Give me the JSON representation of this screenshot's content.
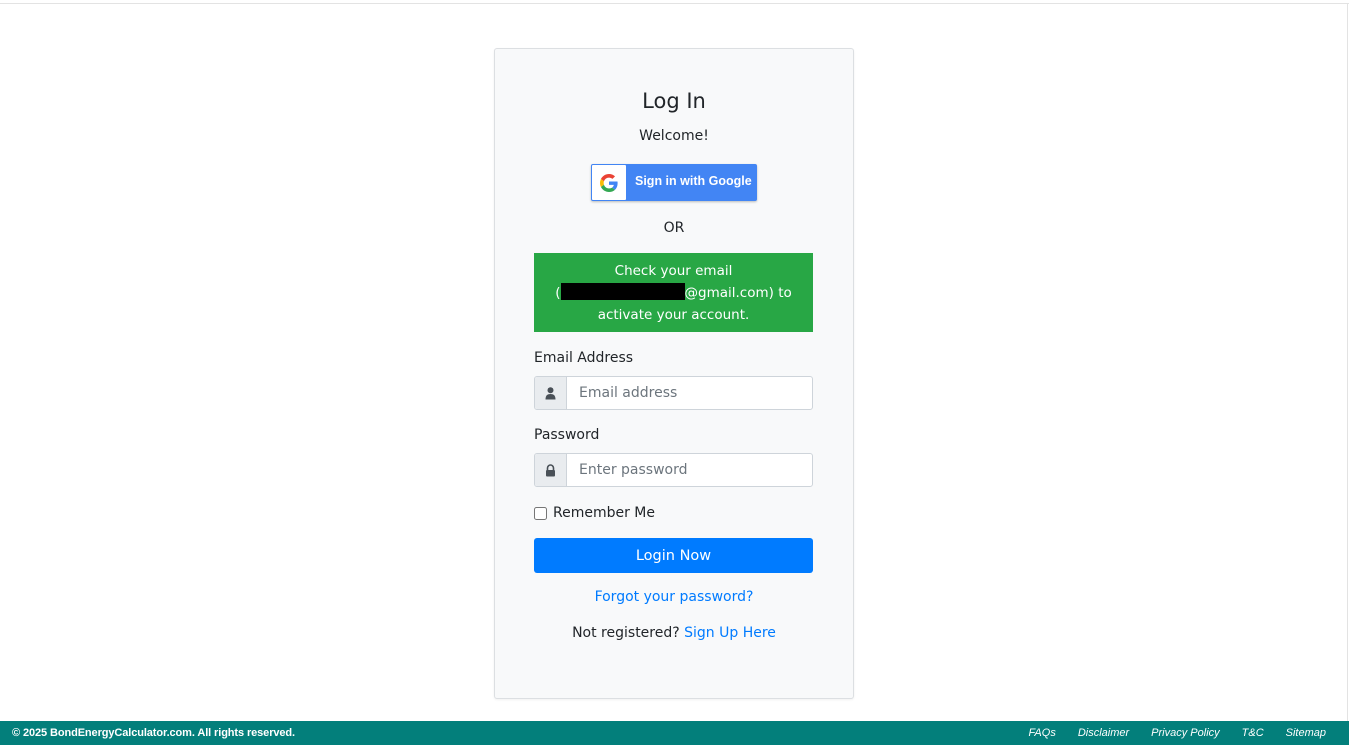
{
  "login": {
    "title": "Log In",
    "welcome": "Welcome!",
    "google_button_label": "Sign in with Google",
    "or_text": "OR",
    "alert": {
      "line1": "Check your email",
      "line2_prefix": "(",
      "line2_suffix": "@gmail.com) to",
      "line3": "activate your account."
    },
    "email": {
      "label": "Email Address",
      "placeholder": "Email address",
      "icon": "user-icon"
    },
    "password": {
      "label": "Password",
      "placeholder": "Enter password",
      "icon": "lock-icon"
    },
    "remember_label": "Remember Me",
    "login_button": "Login Now",
    "forgot_link": "Forgot your password?",
    "not_registered": "Not registered?",
    "signup_link": "Sign Up Here"
  },
  "footer": {
    "copyright": "© 2025 BondEnergyCalculator.com. All rights reserved.",
    "links": [
      "FAQs",
      "Disclaimer",
      "Privacy Policy",
      "T&C",
      "Sitemap"
    ]
  },
  "colors": {
    "google_blue": "#4285f4",
    "success_green": "#28a745",
    "primary_blue": "#007bff",
    "footer_teal": "#037f7b"
  }
}
